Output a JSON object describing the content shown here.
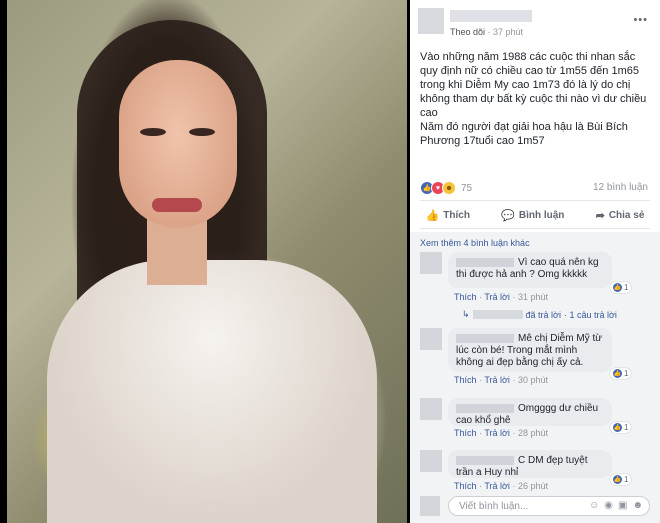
{
  "post": {
    "follow_label": "Theo dõi",
    "separator": " · ",
    "time": "37 phút",
    "more_icon": "•••",
    "paragraphs": [
      "Vào những năm 1988 các cuộc thi nhan sắc quy định nữ có chiều cao từ 1m55 đến 1m65 trong khi Diễm My cao 1m73 đó là lý do chị không tham dự bất kỳ cuộc thi nào vì dư chiều cao",
      "Năm đó người đạt giải hoa hậu là Bùi Bích Phương 17tuổi cao 1m57"
    ],
    "reaction_count": "75",
    "comment_count": "12 bình luận"
  },
  "actions": {
    "like": "Thích",
    "comment": "Bình luận",
    "share": "Chia sẻ"
  },
  "comments_section": {
    "see_more": "Xem thêm 4 bình luận khác",
    "reply_label": "đã trả lời",
    "reply_suffix": "· 1 câu trả lời",
    "write_placeholder": "Viết bình luận...",
    "comments": [
      {
        "text": "Vì cao quá nên kg thi được hả anh ? Omg kkkkk",
        "like": "Thích",
        "reply": "Trả lời",
        "time": "31 phút",
        "likes": "1"
      },
      {
        "text": "Mê chị Diễm Mỹ từ lúc còn bé! Trong mắt mình không ai đẹp bằng chị ấy cả.",
        "like": "Thích",
        "reply": "Trả lời",
        "time": "30 phút",
        "likes": "1"
      },
      {
        "text": "Omgggg dư chiều cao khổ ghê",
        "like": "Thích",
        "reply": "Trả lời",
        "time": "28 phút",
        "likes": "1"
      },
      {
        "text": "C DM đẹp tuyệt trần a Huy nhỉ",
        "like": "Thích",
        "reply": "Trả lời",
        "time": "26 phút",
        "likes": "1"
      }
    ]
  },
  "colors": {
    "link": "#385898",
    "like_blue": "#4267b2",
    "love_red": "#e9435a"
  },
  "icons": [
    "more-icon",
    "like-reaction-icon",
    "love-reaction-icon",
    "haha-reaction-icon",
    "thumbs-up-icon",
    "comment-icon",
    "share-icon",
    "reply-arrow-icon",
    "emoji-icon",
    "camera-icon",
    "gif-icon",
    "sticker-icon"
  ]
}
